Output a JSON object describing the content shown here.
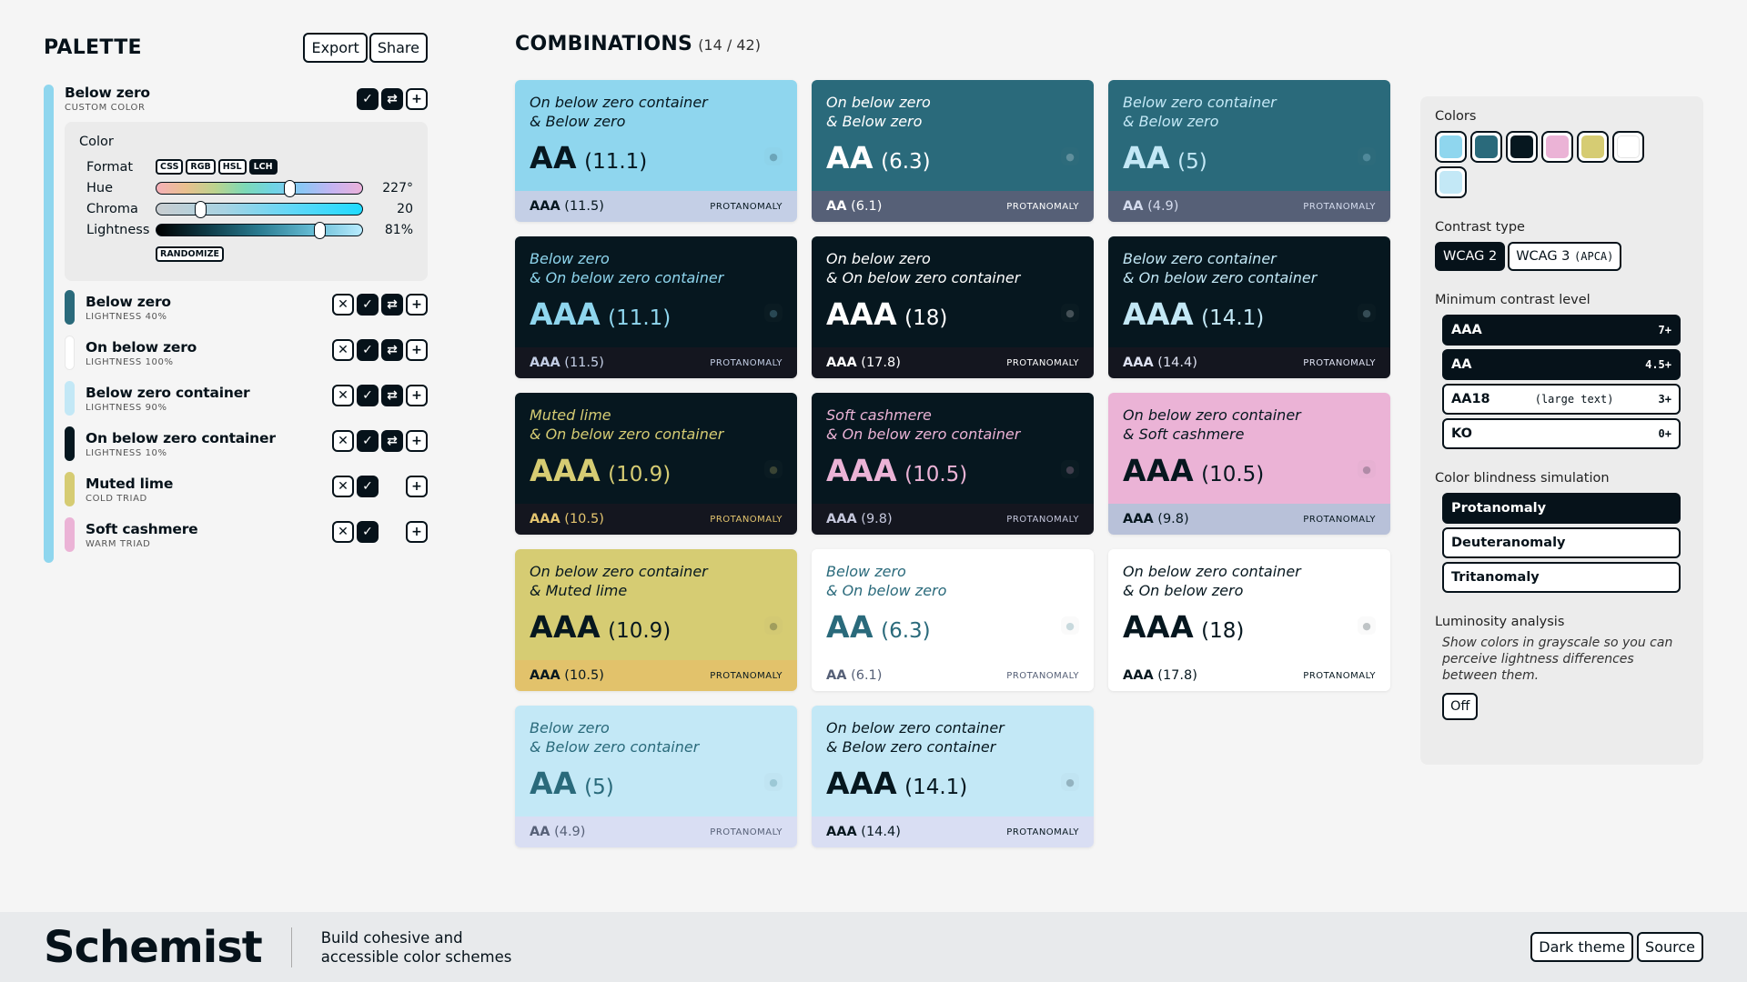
{
  "palette": {
    "title": "PALETTE",
    "export_label": "Export",
    "share_label": "Share",
    "selected": {
      "name": "Below zero",
      "sub": "CUSTOM COLOR",
      "color": "#8fd6ee",
      "editor": {
        "title": "Color",
        "format_label": "Format",
        "formats": [
          "CSS",
          "RGB",
          "HSL",
          "LCH"
        ],
        "active_format": "LCH",
        "hue_label": "Hue",
        "hue_value": "227°",
        "chroma_label": "Chroma",
        "chroma_value": "20",
        "lightness_label": "Lightness",
        "lightness_value": "81%",
        "randomize_label": "RANDOMIZE"
      }
    },
    "items": [
      {
        "name": "Below zero",
        "sub": "LIGHTNESS 40%",
        "color": "#2a6a7b"
      },
      {
        "name": "On below zero",
        "sub": "LIGHTNESS 100%",
        "color": "#ffffff"
      },
      {
        "name": "Below zero container",
        "sub": "LIGHTNESS 90%",
        "color": "#c3e8f6"
      },
      {
        "name": "On below zero container",
        "sub": "LIGHTNESS 10%",
        "color": "#06171f"
      },
      {
        "name": "Muted lime",
        "sub": "COLD TRIAD",
        "color": "#d6cc73"
      },
      {
        "name": "Soft cashmere",
        "sub": "WARM TRIAD",
        "color": "#ebb3d6"
      }
    ]
  },
  "combinations": {
    "title": "COMBINATIONS",
    "count": "(14 / 42)",
    "cards": [
      {
        "l1": "On below zero container",
        "l2": "& Below zero",
        "grade": "AA",
        "score": "(11.1)",
        "bgrade": "AAA",
        "bscore": "(11.5)",
        "sim": "PROTANOMALY",
        "bg": "#8fd6ee",
        "fg": "#06171f",
        "bbg": "#c4cfe6",
        "bfg": "#06171f"
      },
      {
        "l1": "On below zero",
        "l2": "& Below zero",
        "grade": "AA",
        "score": "(6.3)",
        "bgrade": "AA",
        "bscore": "(6.1)",
        "sim": "PROTANOMALY",
        "bg": "#2a6a7b",
        "fg": "#ffffff",
        "bbg": "#566077",
        "bfg": "#ffffff"
      },
      {
        "l1": "Below zero container",
        "l2": "& Below zero",
        "grade": "AA",
        "score": "(5)",
        "bgrade": "AA",
        "bscore": "(4.9)",
        "sim": "PROTANOMALY",
        "bg": "#2a6a7b",
        "fg": "#c3e8f6",
        "bbg": "#566077",
        "bfg": "#d5dcee"
      },
      {
        "l1": "Below zero",
        "l2": "& On below zero container",
        "grade": "AAA",
        "score": "(11.1)",
        "bgrade": "AAA",
        "bscore": "(11.5)",
        "sim": "PROTANOMALY",
        "bg": "#06171f",
        "fg": "#8fd6ee",
        "bbg": "#14161f",
        "bfg": "#c4cfe6"
      },
      {
        "l1": "On below zero",
        "l2": "& On below zero container",
        "grade": "AAA",
        "score": "(18)",
        "bgrade": "AAA",
        "bscore": "(17.8)",
        "sim": "PROTANOMALY",
        "bg": "#06171f",
        "fg": "#ffffff",
        "bbg": "#14161f",
        "bfg": "#ffffff"
      },
      {
        "l1": "Below zero container",
        "l2": "& On below zero container",
        "grade": "AAA",
        "score": "(14.1)",
        "bgrade": "AAA",
        "bscore": "(14.4)",
        "sim": "PROTANOMALY",
        "bg": "#06171f",
        "fg": "#c3e8f6",
        "bbg": "#14161f",
        "bfg": "#dfe3f3"
      },
      {
        "l1": "Muted lime",
        "l2": "& On below zero container",
        "grade": "AAA",
        "score": "(10.9)",
        "bgrade": "AAA",
        "bscore": "(10.5)",
        "sim": "PROTANOMALY",
        "bg": "#06171f",
        "fg": "#d6cc73",
        "bbg": "#14161f",
        "bfg": "#e4c56f"
      },
      {
        "l1": "Soft cashmere",
        "l2": "& On below zero container",
        "grade": "AAA",
        "score": "(10.5)",
        "bgrade": "AAA",
        "bscore": "(9.8)",
        "sim": "PROTANOMALY",
        "bg": "#06171f",
        "fg": "#ebb3d6",
        "bbg": "#14161f",
        "bfg": "#c5c7dc"
      },
      {
        "l1": "On below zero container",
        "l2": "& Soft cashmere",
        "grade": "AAA",
        "score": "(10.5)",
        "bgrade": "AAA",
        "bscore": "(9.8)",
        "sim": "PROTANOMALY",
        "bg": "#ebb3d6",
        "fg": "#06171f",
        "bbg": "#b8c1d9",
        "bfg": "#06171f"
      },
      {
        "l1": "On below zero container",
        "l2": "& Muted lime",
        "grade": "AAA",
        "score": "(10.9)",
        "bgrade": "AAA",
        "bscore": "(10.5)",
        "sim": "PROTANOMALY",
        "bg": "#d6cc73",
        "fg": "#06171f",
        "bbg": "#e2c26b",
        "bfg": "#06171f"
      },
      {
        "l1": "Below zero",
        "l2": "& On below zero",
        "grade": "AA",
        "score": "(6.3)",
        "bgrade": "AA",
        "bscore": "(6.1)",
        "sim": "PROTANOMALY",
        "bg": "#ffffff",
        "fg": "#2a6a7b",
        "bbg": "#ffffff",
        "bfg": "#566077"
      },
      {
        "l1": "On below zero container",
        "l2": "& On below zero",
        "grade": "AAA",
        "score": "(18)",
        "bgrade": "AAA",
        "bscore": "(17.8)",
        "sim": "PROTANOMALY",
        "bg": "#ffffff",
        "fg": "#06171f",
        "bbg": "#ffffff",
        "bfg": "#06171f"
      },
      {
        "l1": "Below zero",
        "l2": "& Below zero container",
        "grade": "AA",
        "score": "(5)",
        "bgrade": "AA",
        "bscore": "(4.9)",
        "sim": "PROTANOMALY",
        "bg": "#c3e8f6",
        "fg": "#2a6a7b",
        "bbg": "#d9def3",
        "bfg": "#566077"
      },
      {
        "l1": "On below zero container",
        "l2": "& Below zero container",
        "grade": "AAA",
        "score": "(14.1)",
        "bgrade": "AAA",
        "bscore": "(14.4)",
        "sim": "PROTANOMALY",
        "bg": "#c3e8f6",
        "fg": "#06171f",
        "bbg": "#d9def3",
        "bfg": "#06171f"
      }
    ]
  },
  "settings": {
    "colors_label": "Colors",
    "swatches": [
      "#8fd6ee",
      "#2a6a7b",
      "#06171f",
      "#ebb3d6",
      "#d6cc73",
      "#ffffff",
      "#c3e8f6"
    ],
    "contrast_type_label": "Contrast type",
    "contrast_types": [
      {
        "label": "WCAG 2",
        "suffix": "",
        "active": true
      },
      {
        "label": "WCAG 3",
        "suffix": "(APCA)",
        "active": false
      }
    ],
    "min_level_label": "Minimum contrast level",
    "levels": [
      {
        "name": "AAA",
        "note": "",
        "value": "7+",
        "active": true
      },
      {
        "name": "AA",
        "note": "",
        "value": "4.5+",
        "active": true
      },
      {
        "name": "AA18",
        "note": "(large text)",
        "value": "3+",
        "active": false
      },
      {
        "name": "KO",
        "note": "",
        "value": "0+",
        "active": false
      }
    ],
    "cb_label": "Color blindness simulation",
    "cb_options": [
      {
        "label": "Protanomaly",
        "active": true
      },
      {
        "label": "Deuteranomaly",
        "active": false
      },
      {
        "label": "Tritanomaly",
        "active": false
      }
    ],
    "lum_label": "Luminosity analysis",
    "lum_desc": "Show colors in grayscale so you can perceive lightness differences between them.",
    "lum_button": "Off"
  },
  "footer": {
    "logo": "Schemist",
    "tagline": "Build cohesive and accessible color schemes",
    "dark_theme_label": "Dark theme",
    "source_label": "Source"
  }
}
